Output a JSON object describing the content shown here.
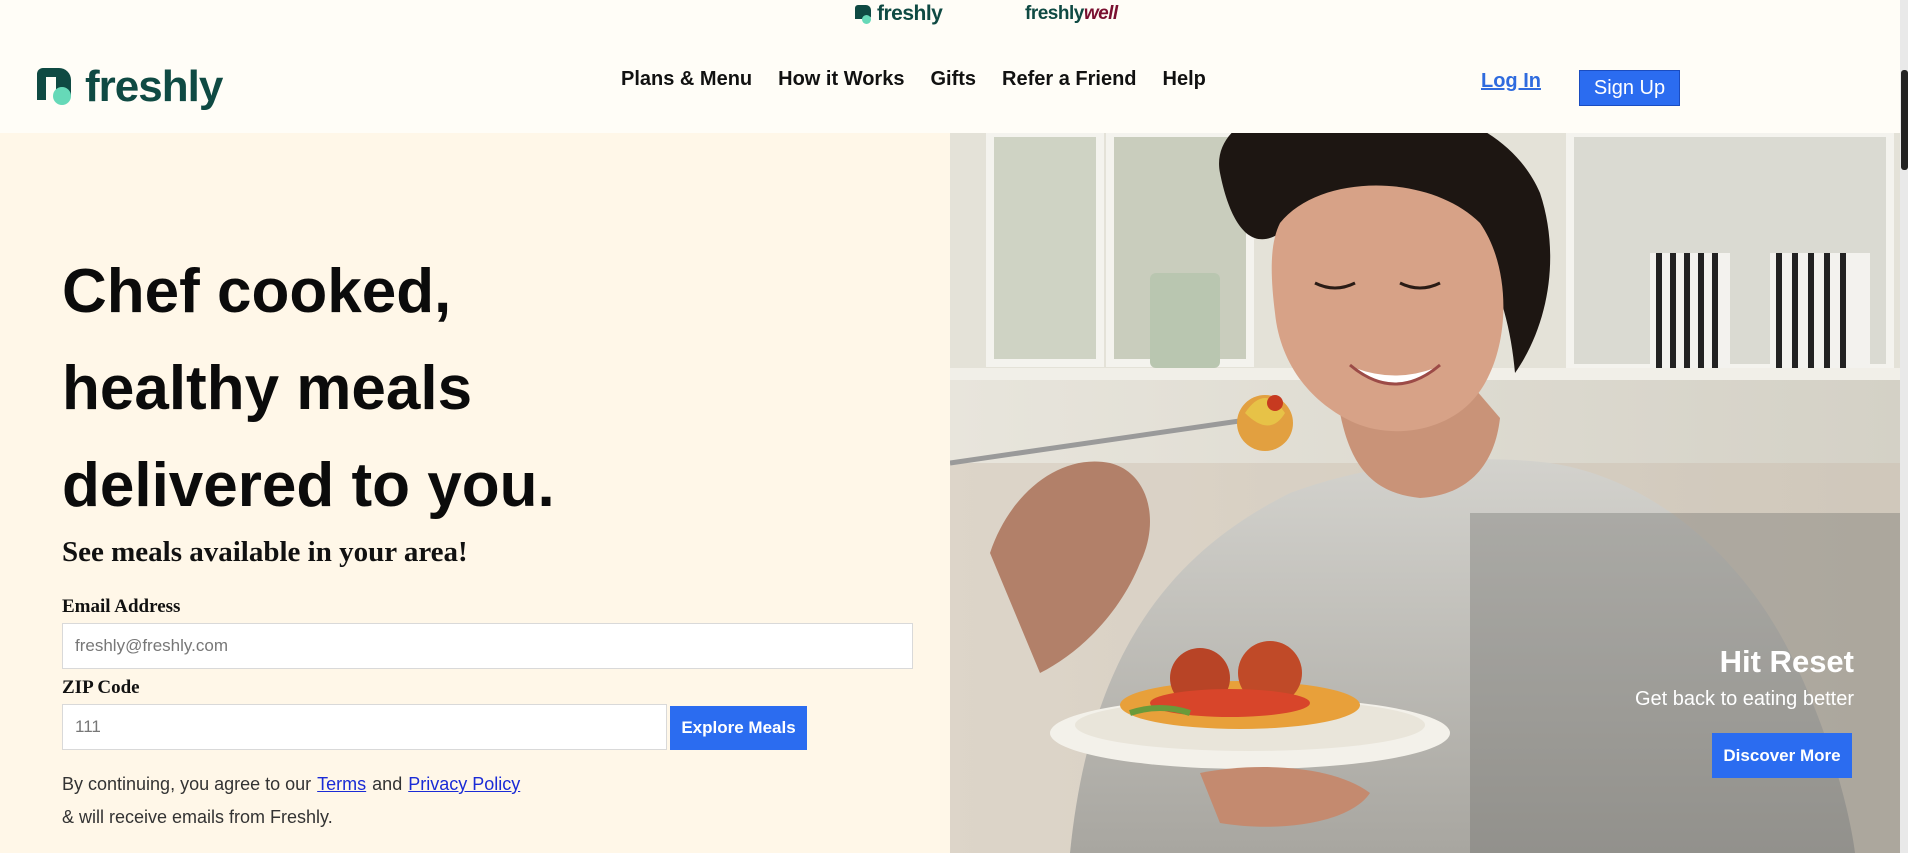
{
  "brand_strip": {
    "freshly": "freshly",
    "freshlywell_prefix": "freshly",
    "freshlywell_suffix": "well"
  },
  "header": {
    "logo_text": "freshly",
    "nav": [
      "Plans & Menu",
      "How it Works",
      "Gifts",
      "Refer a Friend",
      "Help"
    ],
    "login_label": "Log In",
    "signup_label": "Sign Up"
  },
  "hero": {
    "headline_lines": [
      "Chef cooked,",
      "healthy meals",
      "delivered to you."
    ],
    "subhead": "See meals available in your area!",
    "email_label": "Email Address",
    "email_placeholder": "freshly@freshly.com",
    "zip_label": "ZIP Code",
    "zip_value": "111",
    "explore_label": "Explore Meals",
    "legal_prefix": "By continuing, you agree to our",
    "terms_label": "Terms",
    "and_text": "and",
    "privacy_label": "Privacy Policy",
    "legal_line2": "& will receive emails from Freshly."
  },
  "promo": {
    "title": "Hit Reset",
    "subtitle": "Get back to eating better",
    "button_label": "Discover More"
  },
  "colors": {
    "brand_green": "#0f4a43",
    "brand_mint": "#66d9b8",
    "accent_blue": "#2b6cf0",
    "hero_bg": "#fff7e8"
  }
}
